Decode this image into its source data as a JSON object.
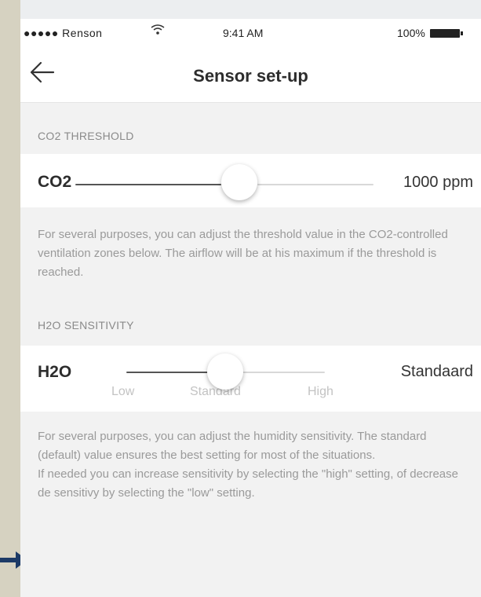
{
  "status_bar": {
    "carrier": "●●●●● Renson",
    "time": "9:41 AM",
    "battery": "100%"
  },
  "nav": {
    "title": "Sensor set-up",
    "back_icon": "arrow-left-icon"
  },
  "co2": {
    "section_header": "CO2 THRESHOLD",
    "label": "CO2",
    "value": "1000 ppm",
    "slider_fraction": 0.55,
    "description": "For several purposes, you can adjust the threshold value in the CO2-controlled ventilation zones below. The airflow will be at his maximum if the threshold is reached."
  },
  "h2o": {
    "section_header": "H2O SENSITIVITY",
    "label": "H2O",
    "value": "Standaard",
    "options": [
      "Low",
      "Standard",
      "High"
    ],
    "selected_index": 1,
    "description": [
      "For several purposes, you can adjust the humidity sensitivity. The standard (default) value ensures the best setting for most of the situations.",
      "If needed you can increase sensitivity by selecting the \"high\" setting, of decrease de sensitivy by selecting the \"low\" setting."
    ]
  },
  "colors": {
    "arrow_marker": "#1c3a66",
    "track_active": "#555555",
    "track_inactive": "#d8d8d8"
  }
}
